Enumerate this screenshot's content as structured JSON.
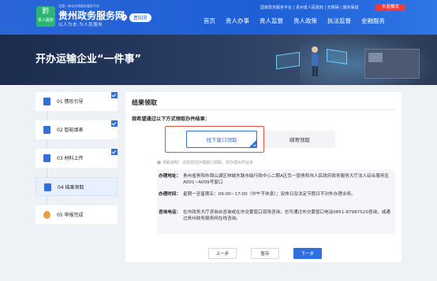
{
  "header": {
    "logo_badge": "黔",
    "logo_badge_sub": "贵人服务",
    "logo_small": "全国一体化在线政务服务平台",
    "logo_title": "贵州政务服务网",
    "logo_slogan": "以人为本·为人民服务",
    "city": "贵阳市",
    "toplinks": "国家政务服务平台 | 贵州省人民政府 | 无障碍 | 服务渠道",
    "elder_mode": "长者模式",
    "nav": [
      "首页",
      "贵人办事",
      "贵人监督",
      "贵人政策",
      "执法监督",
      "金融服务"
    ]
  },
  "banner": {
    "title": "开办运输企业“一件事”"
  },
  "steps": [
    {
      "label": "01 情形引导",
      "done": true
    },
    {
      "label": "02 智能填表",
      "done": true
    },
    {
      "label": "03 材料上传",
      "done": true
    },
    {
      "label": "04 结果领取",
      "done": false,
      "active": true
    },
    {
      "label": "05 申报完成",
      "done": false
    }
  ],
  "main": {
    "title": "结果领取",
    "question": "我希望通过以下方式领取办件结果：",
    "options": [
      {
        "label": "线下窗口领取",
        "selected": true
      },
      {
        "label": "邮寄领取",
        "selected": false
      }
    ],
    "note": "领取说明：请您前往办理窗口领取，并办理出件业务",
    "info": [
      {
        "key": "办理地址：",
        "value": "贵州省贵阳市观山湖区林城东路市级行政中心二期A区负一层贵阳市人民政府政务服务大厅法人综合服务区A001~A009号窗口"
      },
      {
        "key": "办理时间：",
        "value": "星期一至星期五：09:00~17:00（中午不休息）；双休日及法定节假日不对外办理业务。"
      },
      {
        "key": "咨询电话：",
        "value": "在市政务大厅咨询台咨询或在市交委窗口现场咨询，也可通过市交委窗口电话0851-87987520咨询，或通过贵州政务服务网在线咨询。"
      }
    ],
    "buttons": {
      "prev": "上一步",
      "save": "暂存",
      "next": "下一步"
    }
  },
  "colors": {
    "primary": "#2f6fe0",
    "header": "#1e5fd6",
    "highlight_border": "#e9503d",
    "elder_mode": "#ee3b3b",
    "logo": "#2bb673"
  }
}
